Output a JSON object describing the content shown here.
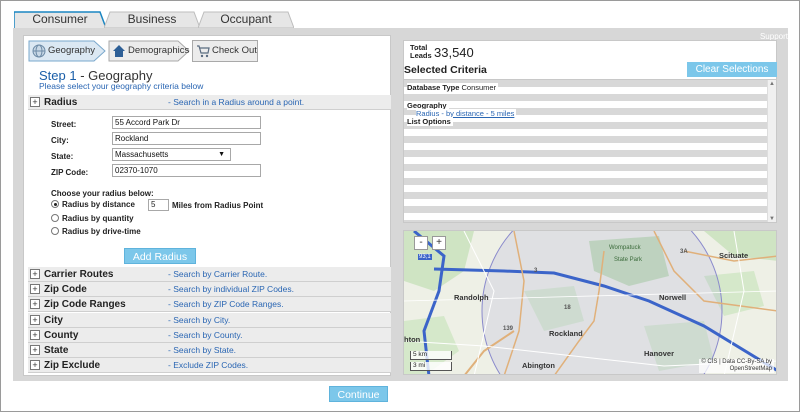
{
  "tabs": [
    {
      "label": "Consumer",
      "active": true
    },
    {
      "label": "Business",
      "active": false
    },
    {
      "label": "Occupant",
      "active": false
    }
  ],
  "steps": [
    {
      "label": "Geography",
      "icon": "globe-icon"
    },
    {
      "label": "Demographics",
      "icon": "house-icon"
    },
    {
      "label": "Check Out",
      "icon": "cart-icon"
    }
  ],
  "step_title": {
    "prefix": "Step 1",
    "name": "- Geography"
  },
  "step_desc": "Please select your geography criteria below",
  "radius": {
    "label": "Radius",
    "desc": "- Search in a Radius around a point.",
    "street_label": "Street:",
    "street": "55 Accord Park Dr",
    "city_label": "City:",
    "city": "Rockland",
    "state_label": "State:",
    "state": "Massachusetts",
    "zip_label": "ZIP Code:",
    "zip": "02370-1070",
    "choose": "Choose your radius below:",
    "opt_distance": "Radius by distance",
    "distance": "5",
    "distance_suffix": "Miles from Radius Point",
    "opt_quantity": "Radius by quantity",
    "opt_drive": "Radius by drive-time",
    "add_button": "Add Radius"
  },
  "sections": [
    {
      "label": "Carrier Routes",
      "desc": "- Search by Carrier Route."
    },
    {
      "label": "Zip Code",
      "desc": "- Search by individual ZIP Codes."
    },
    {
      "label": "Zip Code Ranges",
      "desc": "- Search by ZIP Code Ranges."
    },
    {
      "label": "City",
      "desc": "- Search by City."
    },
    {
      "label": "County",
      "desc": "- Search by County."
    },
    {
      "label": "State",
      "desc": "- Search by State."
    },
    {
      "label": "Zip Exclude",
      "desc": "- Exclude ZIP Codes."
    }
  ],
  "support": "Support",
  "total": {
    "label1": "Total",
    "label2": "Leads",
    "value": "33,540"
  },
  "selected_title": "Selected Criteria",
  "clear_button": "Clear Selections",
  "criteria": {
    "db_label": "Database Type",
    "db_value": "Consumer",
    "geo_label": "Geography",
    "geo_item": "Radius - by distance - 5 miles",
    "list_label": "List Options"
  },
  "map": {
    "zoom_in": "+",
    "zoom_out": "-",
    "scale_km": "5 km",
    "scale_mi": "3 mi",
    "attrib1": "© CIS | Data CC-By-SA by",
    "attrib2": "OpenStreetMap",
    "labels": {
      "randolph": "Randolph",
      "norwell": "Norwell",
      "rockland": "Rockland",
      "abington": "Abington",
      "scituate": "Scituate",
      "hanover": "Hanover",
      "ahton": "hton",
      "wompatuck": "Wompatuck",
      "state_park": "State Park",
      "r3a": "3A",
      "r3": "3",
      "r93": "93;1",
      "r139": "139",
      "r18": "18"
    }
  },
  "continue_button": "Continue"
}
